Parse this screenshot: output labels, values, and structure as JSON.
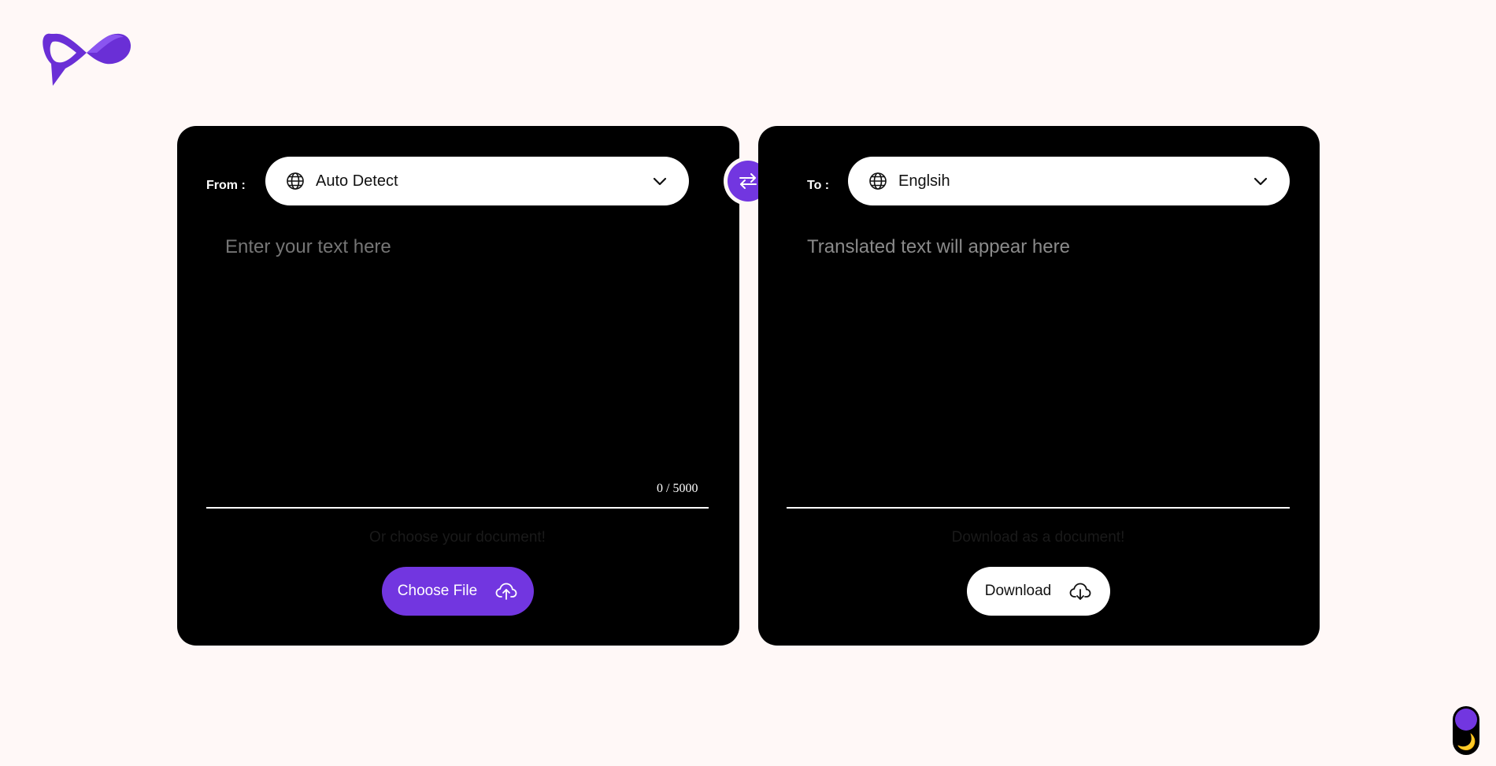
{
  "app": {
    "logo": "infinity-logo",
    "accent_color": "#7236e0",
    "background_color": "#fff8f7",
    "panel_color": "#000000"
  },
  "source": {
    "label": "From :",
    "language": "Auto Detect",
    "placeholder": "Enter your text here",
    "char_count": "0 / 5000",
    "hint": "Or choose your document!",
    "button_label": "Choose File",
    "button_icon": "cloud-upload-icon"
  },
  "swap": {
    "icon": "swap-arrows-icon"
  },
  "target": {
    "label": "To :",
    "language": "Englsih",
    "placeholder": "Translated text will appear here",
    "hint": "Download as a document!",
    "button_label": "Download",
    "button_icon": "cloud-download-icon"
  },
  "theme_toggle": {
    "mode": "dark",
    "icon": "moon-icon",
    "glyph": "🌙"
  }
}
